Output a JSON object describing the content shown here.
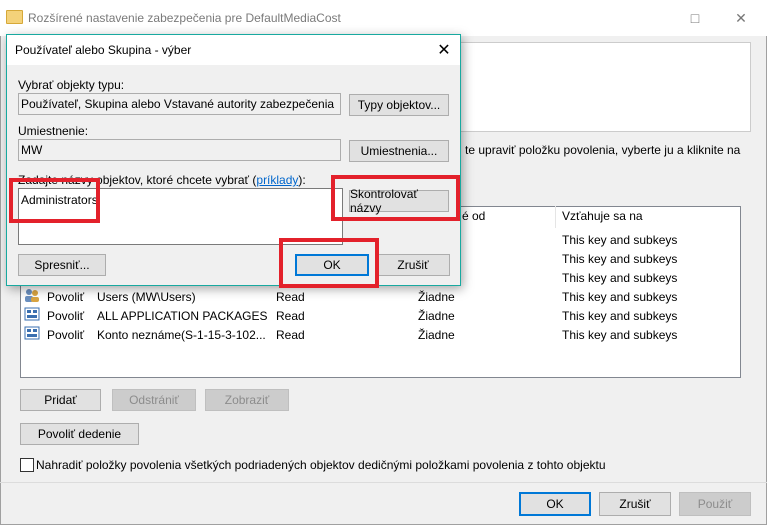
{
  "bg_window": {
    "title": "Rozšírené nastavenie zabezpečenia pre DefaultMediaCost",
    "description": "te upraviť položku povolenia, vyberte ju a kliknite na",
    "columns": [
      "é od",
      "Vzťahuje sa na"
    ],
    "rows_partial": [
      {
        "applies_to": "This key and subkeys"
      },
      {
        "applies_to": "This key and subkeys"
      },
      {
        "applies_to": "This key and subkeys"
      }
    ],
    "rows": [
      {
        "type": "Povoliť",
        "principal": "Users (MW\\Users)",
        "access": "Read",
        "inherited": "Žiadne",
        "applies_to": "This key and subkeys"
      },
      {
        "type": "Povoliť",
        "principal": "ALL APPLICATION PACKAGES",
        "access": "Read",
        "inherited": "Žiadne",
        "applies_to": "This key and subkeys"
      },
      {
        "type": "Povoliť",
        "principal": "Konto neznáme(S-1-15-3-102...",
        "access": "Read",
        "inherited": "Žiadne",
        "applies_to": "This key and subkeys"
      }
    ],
    "btn_add": "Pridať",
    "btn_remove": "Odstrániť",
    "btn_view": "Zobraziť",
    "btn_enable_inheritance": "Povoliť dedenie",
    "replace_checkbox_label": "Nahradiť položky povolenia všetkých podriadených objektov dedičnými položkami povolenia z tohto objektu",
    "btn_ok": "OK",
    "btn_cancel": "Zrušiť",
    "btn_apply": "Použiť"
  },
  "dialog": {
    "title": "Používateľ alebo Skupina - výber",
    "object_types_label": "Vybrať objekty typu:",
    "object_types_value": "Používateľ, Skupina alebo Vstavané autority zabezpečenia",
    "btn_object_types": "Typy objektov...",
    "location_label": "Umiestnenie:",
    "location_value": "MW",
    "btn_locations": "Umiestnenia...",
    "names_label_prefix": "Zadajte názvy objektov, ktoré chcete vybrať (",
    "names_label_link": "príklady",
    "names_label_suffix": "):",
    "names_value": "Administrators",
    "btn_check_names": "Skontrolovať názvy",
    "btn_advanced": "Spresniť...",
    "btn_ok": "OK",
    "btn_cancel": "Zrušiť"
  },
  "colors": {
    "highlight": "#e3212b",
    "dialog_border": "#18a9a0",
    "focus": "#0078d7"
  }
}
